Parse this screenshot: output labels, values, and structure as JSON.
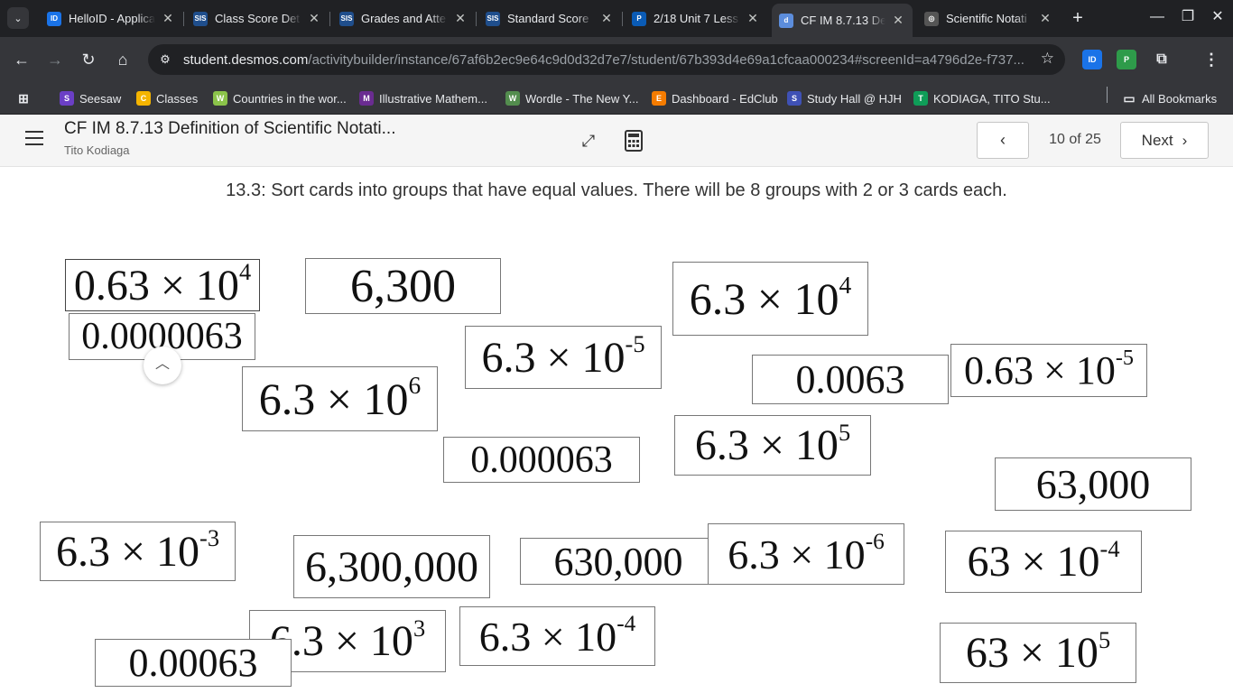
{
  "browser": {
    "tabs": [
      {
        "label": "HelloID - Applicat",
        "icon": "id",
        "color": "#1a73e8"
      },
      {
        "label": "Class Score Det",
        "icon": "sis",
        "color": "#1f4e8c"
      },
      {
        "label": "Grades and Atte",
        "icon": "sis",
        "color": "#1f4e8c"
      },
      {
        "label": "Standard Score",
        "icon": "sis",
        "color": "#1f4e8c"
      },
      {
        "label": "2/18 Unit 7 Less",
        "icon": "p",
        "color": "#0a5bb5"
      },
      {
        "label": "CF IM 8.7.13 De",
        "icon": "d",
        "color": "#5c8ddc"
      },
      {
        "label": "Scientific Notati",
        "icon": "openai",
        "color": "#555"
      }
    ],
    "url_host": "student.desmos.com",
    "url_path": "/activitybuilder/instance/67af6b2ec9e64c9d0d32d7e7/student/67b393d4e69a1cfcaa000234#screenId=a4796d2e-f737...",
    "bookmarks": [
      {
        "label": "Seesaw",
        "color": "#6b3fc5",
        "glyph": "S"
      },
      {
        "label": "Classes",
        "color": "#f4b400",
        "glyph": "C"
      },
      {
        "label": "Countries in the wor...",
        "color": "#8bc34a",
        "glyph": "W"
      },
      {
        "label": "Illustrative Mathem...",
        "color": "#6a2c91",
        "glyph": "M"
      },
      {
        "label": "Wordle - The New Y...",
        "color": "#538d4e",
        "glyph": "W"
      },
      {
        "label": "Dashboard - EdClub",
        "color": "#f57c00",
        "glyph": "E"
      },
      {
        "label": "Study Hall @ HJH",
        "color": "#3f51b5",
        "glyph": "S"
      },
      {
        "label": "KODIAGA, TITO Stu...",
        "color": "#0f9d58",
        "glyph": "T"
      }
    ],
    "all_bookmarks": "All Bookmarks"
  },
  "activity": {
    "title": "CF IM 8.7.13 Definition of Scientific Notati...",
    "student": "Tito Kodiaga",
    "page_counter": "10 of 25",
    "next_label": "Next"
  },
  "prompt": "13.3: Sort cards into groups that have equal values. There will be 8 groups with 2 or 3 cards each.",
  "cards": [
    {
      "base": "0.63 × 10",
      "exp": "4"
    },
    {
      "base": "0.0000063",
      "exp": ""
    },
    {
      "base": "6,300",
      "exp": ""
    },
    {
      "base": "6.3 × 10",
      "exp": "4"
    },
    {
      "base": "6.3 × 10",
      "exp": "-5"
    },
    {
      "base": "6.3 × 10",
      "exp": "6"
    },
    {
      "base": "0.0063",
      "exp": ""
    },
    {
      "base": "0.63 × 10",
      "exp": "-5"
    },
    {
      "base": "6.3 × 10",
      "exp": "5"
    },
    {
      "base": "0.000063",
      "exp": ""
    },
    {
      "base": "63,000",
      "exp": ""
    },
    {
      "base": "6.3 × 10",
      "exp": "-3"
    },
    {
      "base": "6,300,000",
      "exp": ""
    },
    {
      "base": "630,000",
      "exp": ""
    },
    {
      "base": "6.3 × 10",
      "exp": "-6"
    },
    {
      "base": "63 × 10",
      "exp": "-4"
    },
    {
      "base": "6.3 × 10",
      "exp": "3"
    },
    {
      "base": "6.3 × 10",
      "exp": "-4"
    },
    {
      "base": "0.00063",
      "exp": ""
    },
    {
      "base": "63 × 10",
      "exp": "5"
    }
  ]
}
